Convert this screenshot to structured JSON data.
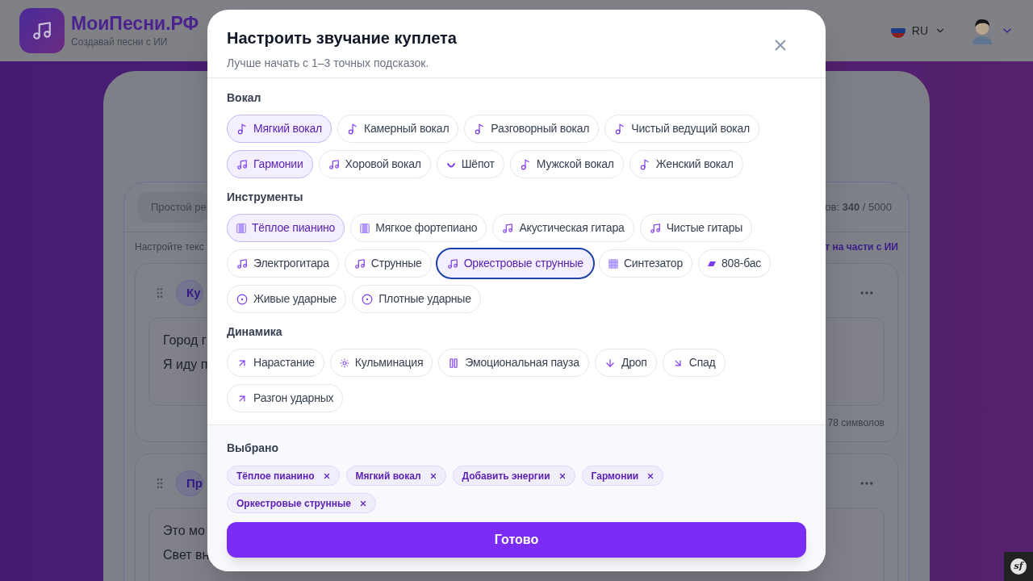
{
  "header": {
    "brand": "МоиПесни.РФ",
    "tagline": "Создавай песни с ИИ",
    "language": "RU"
  },
  "editor": {
    "mode_tab": "Простой ре",
    "counter": "ов: **340** / 5000",
    "hint": "Настройте текс",
    "ai_link": "т на части с ИИ",
    "sections": [
      {
        "tag": "Ку",
        "lines": [
          "Город г",
          "Я иду п"
        ],
        "footer": "78 символов"
      },
      {
        "tag": "Пр",
        "lines": [
          "Это мо",
          "Свет вн"
        ]
      }
    ]
  },
  "modal": {
    "title": "Настроить звучание куплета",
    "subtitle": "Лучше начать с 1–3 точных подсказок.",
    "groups": [
      {
        "title": "Вокал",
        "chips": [
          {
            "label": "Мягкий вокал",
            "kind": "note",
            "selected": true,
            "focused": false
          },
          {
            "label": "Камерный вокал",
            "kind": "note",
            "selected": false,
            "focused": false
          },
          {
            "label": "Разговорный вокал",
            "kind": "note",
            "selected": false,
            "focused": false
          },
          {
            "label": "Чистый ведущий вокал",
            "kind": "note",
            "selected": false,
            "focused": false
          },
          {
            "label": "Гармонии",
            "kind": "notes",
            "selected": true,
            "focused": false
          },
          {
            "label": "Хоровой вокал",
            "kind": "notes",
            "selected": false,
            "focused": false
          },
          {
            "label": "Шёпот",
            "kind": "arc",
            "selected": false,
            "focused": false
          },
          {
            "label": "Мужской вокал",
            "kind": "note",
            "selected": false,
            "focused": false
          },
          {
            "label": "Женский вокал",
            "kind": "note",
            "selected": false,
            "focused": false
          }
        ]
      },
      {
        "title": "Инструменты",
        "chips": [
          {
            "label": "Тёплое пианино",
            "kind": "piano",
            "selected": true,
            "focused": false
          },
          {
            "label": "Мягкое фортепиано",
            "kind": "piano",
            "selected": false,
            "focused": false
          },
          {
            "label": "Акустическая гитара",
            "kind": "notes",
            "selected": false,
            "focused": false
          },
          {
            "label": "Чистые гитары",
            "kind": "notes",
            "selected": false,
            "focused": false
          },
          {
            "label": "Электрогитара",
            "kind": "notes",
            "selected": false,
            "focused": false
          },
          {
            "label": "Струнные",
            "kind": "notes",
            "selected": false,
            "focused": false
          },
          {
            "label": "Оркестровые струнные",
            "kind": "notes",
            "selected": true,
            "focused": true
          },
          {
            "label": "Синтезатор",
            "kind": "grid",
            "selected": false,
            "focused": false
          },
          {
            "label": "808-бас",
            "kind": "bass",
            "selected": false,
            "focused": false
          },
          {
            "label": "Живые ударные",
            "kind": "drum",
            "selected": false,
            "focused": false
          },
          {
            "label": "Плотные ударные",
            "kind": "drum",
            "selected": false,
            "focused": false
          }
        ]
      },
      {
        "title": "Динамика",
        "chips": [
          {
            "label": "Нарастание",
            "kind": "up-right",
            "selected": false,
            "focused": false
          },
          {
            "label": "Кульминация",
            "kind": "burst",
            "selected": false,
            "focused": false
          },
          {
            "label": "Эмоциональная пауза",
            "kind": "pause",
            "selected": false,
            "focused": false
          },
          {
            "label": "Дроп",
            "kind": "down",
            "selected": false,
            "focused": false
          },
          {
            "label": "Спад",
            "kind": "down-right",
            "selected": false,
            "focused": false
          },
          {
            "label": "Разгон ударных",
            "kind": "up-right",
            "selected": false,
            "focused": false
          }
        ]
      }
    ],
    "selected_title": "Выбрано",
    "selected": [
      "Тёплое пианино",
      "Мягкий вокал",
      "Добавить энергии",
      "Гармонии",
      "Оркестровые струнные"
    ],
    "done_button": "Готово"
  },
  "debug_toolbar": {
    "label": "sf"
  }
}
